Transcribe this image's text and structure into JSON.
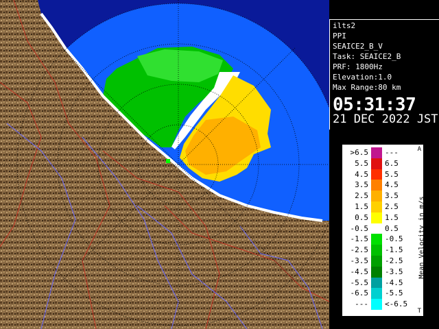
{
  "info": {
    "site": "ilts2",
    "scan_type": "PPI",
    "product": "SEAICE2_B_V",
    "task": "Task: SEAICE2_B",
    "prf": "PRF: 1800Hz",
    "elevation": "Elevation:1.0",
    "max_range": "Max Range:80 km",
    "time": "05:31:37",
    "date": "21 DEC 2022 JST"
  },
  "legend": {
    "title": "Mean Velocity in m/s",
    "corner_top": "A",
    "corner_bottom": "T",
    "rows": [
      {
        "lo": ">6.5",
        "hi": "---",
        "color": "#c0178f"
      },
      {
        "lo": "5.5",
        "hi": "6.5",
        "color": "#e01010"
      },
      {
        "lo": "4.5",
        "hi": "5.5",
        "color": "#ff3000"
      },
      {
        "lo": "3.5",
        "hi": "4.5",
        "color": "#ff8000"
      },
      {
        "lo": "2.5",
        "hi": "3.5",
        "color": "#ffb000"
      },
      {
        "lo": "1.5",
        "hi": "2.5",
        "color": "#ffd000"
      },
      {
        "lo": "0.5",
        "hi": "1.5",
        "color": "#ffff00"
      },
      {
        "lo": "-0.5",
        "hi": "0.5",
        "color": "#ffffff"
      },
      {
        "lo": "-1.5",
        "hi": "-0.5",
        "color": "#00e000"
      },
      {
        "lo": "-2.5",
        "hi": "-1.5",
        "color": "#00c000"
      },
      {
        "lo": "-3.5",
        "hi": "-2.5",
        "color": "#00a000"
      },
      {
        "lo": "-4.5",
        "hi": "-3.5",
        "color": "#008000"
      },
      {
        "lo": "-5.5",
        "hi": "-4.5",
        "color": "#00a0a0"
      },
      {
        "lo": "-6.5",
        "hi": "-5.5",
        "color": "#00d0d0"
      },
      {
        "lo": "---",
        "hi": "<-6.5",
        "color": "#00ffff"
      }
    ]
  },
  "colors": {
    "sea": "#1060ff",
    "sea_outside": "#1a3ccc",
    "range_ring_area": "#0a1a99",
    "land": "#7a5a3a",
    "land_dark": "#4a3418"
  }
}
